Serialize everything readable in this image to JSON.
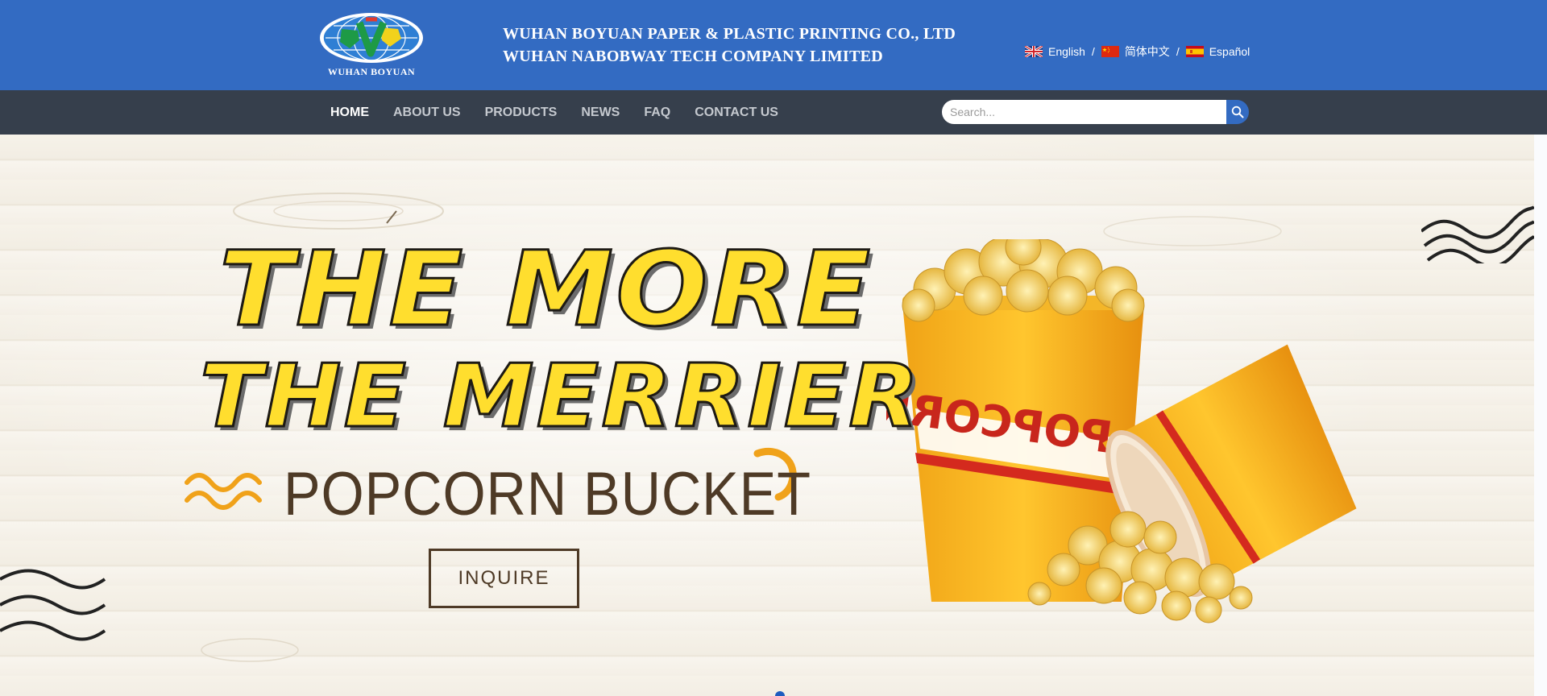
{
  "header": {
    "logo_text": "WUHAN BOYUAN",
    "company_line_1": "WUHAN BOYUAN PAPER & PLASTIC PRINTING CO., LTD",
    "company_line_2": "WUHAN NABOBWAY TECH COMPANY LIMITED",
    "languages": [
      {
        "label": "English",
        "icon": "uk-flag-icon"
      },
      {
        "label": "简体中文",
        "icon": "china-flag-icon"
      },
      {
        "label": "Español",
        "icon": "spain-flag-icon"
      }
    ],
    "language_separator": "/"
  },
  "nav": {
    "items": [
      "HOME",
      "ABOUT US",
      "PRODUCTS",
      "NEWS",
      "FAQ",
      "CONTACT US"
    ],
    "active": "HOME"
  },
  "search": {
    "placeholder": "Search...",
    "value": "",
    "icon": "search-icon"
  },
  "banner": {
    "headline_1": "THE MORE",
    "headline_2": "THE MERRIER",
    "subline": "POPCORN BUCKET",
    "button_label": "INQUIRE",
    "slide_indicator": {
      "current": 1
    }
  },
  "colors": {
    "header_bg": "#336bc2",
    "nav_bg": "#363f4c",
    "headline_yellow": "#ffde2e",
    "text_brown": "#4e3a26",
    "bucket_orange": "#f5a812"
  }
}
